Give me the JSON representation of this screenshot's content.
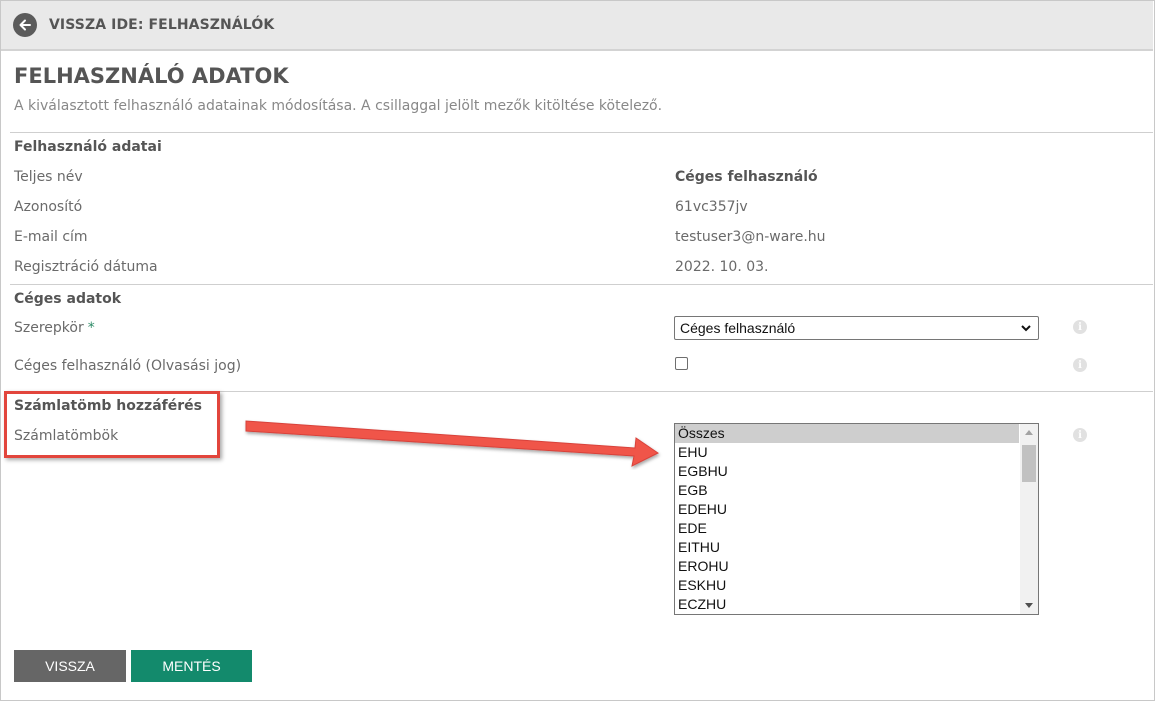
{
  "topbar": {
    "back_label": "VISSZA IDE: FELHASZNÁLÓK"
  },
  "page": {
    "title": "FELHASZNÁLÓ ADATOK",
    "subtitle": "A kiválasztott felhasználó adatainak módosítása. A csillaggal jelölt mezők kitöltése kötelező."
  },
  "user_section": {
    "title": "Felhasználó adatai",
    "full_name_label": "Teljes név",
    "full_name_value": "Céges felhasználó",
    "id_label": "Azonosító",
    "id_value": "61vc357jv",
    "email_label": "E-mail cím",
    "email_value": "testuser3@n-ware.hu",
    "reg_date_label": "Regisztráció dátuma",
    "reg_date_value": "2022. 10. 03."
  },
  "company_section": {
    "title": "Céges adatok",
    "role_label": "Szerepkör",
    "required_mark": "*",
    "role_value": "Céges felhasználó",
    "readonly_label": "Céges felhasználó (Olvasási jog)",
    "readonly_checked": false
  },
  "invoice_section": {
    "title": "Számlatömb hozzáférés",
    "blocks_label": "Számlatömbök",
    "options": [
      "Összes",
      "EHU",
      "EGBHU",
      "EGB",
      "EDEHU",
      "EDE",
      "EITHU",
      "EROHU",
      "ESKHU",
      "ECZHU"
    ],
    "selected": "Összes"
  },
  "info_icon_glyph": "i",
  "buttons": {
    "back": "VISSZA",
    "save": "MENTÉS"
  },
  "colors": {
    "accent": "#138a6c",
    "annotation": "#e2453c",
    "back_button": "#666666"
  }
}
